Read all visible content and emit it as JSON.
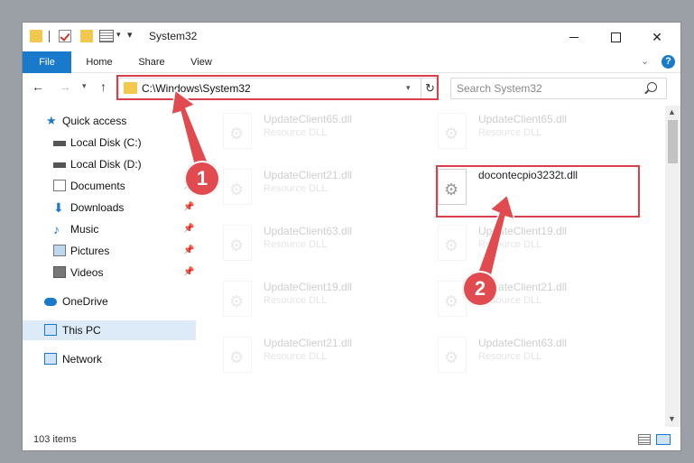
{
  "window": {
    "title": "System32"
  },
  "ribbon": {
    "tabs": [
      "File",
      "Home",
      "Share",
      "View"
    ]
  },
  "address": {
    "path": "C:\\Windows\\System32"
  },
  "search": {
    "placeholder": "Search System32"
  },
  "sidebar": {
    "items": [
      {
        "label": "Quick access",
        "icon": "star-icon",
        "pinned": false
      },
      {
        "label": "Local Disk (C:)",
        "icon": "drive-icon",
        "pinned": false
      },
      {
        "label": "Local Disk (D:)",
        "icon": "drive-icon",
        "pinned": false
      },
      {
        "label": "Documents",
        "icon": "documents-icon",
        "pinned": true
      },
      {
        "label": "Downloads",
        "icon": "download-icon",
        "pinned": true
      },
      {
        "label": "Music",
        "icon": "music-icon",
        "pinned": true
      },
      {
        "label": "Pictures",
        "icon": "pictures-icon",
        "pinned": true
      },
      {
        "label": "Videos",
        "icon": "videos-icon",
        "pinned": true
      },
      {
        "label": "OneDrive",
        "icon": "cloud-icon",
        "pinned": false
      },
      {
        "label": "This PC",
        "icon": "computer-icon",
        "pinned": false,
        "selected": true
      },
      {
        "label": "Network",
        "icon": "network-icon",
        "pinned": false
      }
    ]
  },
  "files": [
    {
      "name": "UpdateClient65.dll",
      "type": "Resource DLL"
    },
    {
      "name": "UpdateClient65.dll",
      "type": "Resource DLL"
    },
    {
      "name": "UpdateClient21.dll",
      "type": "Resource DLL"
    },
    {
      "name": "docontecpio3232t.dll",
      "type": ""
    },
    {
      "name": "UpdateClient63.dll",
      "type": "Resource DLL"
    },
    {
      "name": "UpdateClient19.dll",
      "type": "Resource DLL"
    },
    {
      "name": "UpdateClient19.dll",
      "type": "Resource DLL"
    },
    {
      "name": "UpdateClient21.dll",
      "type": "Resource DLL"
    },
    {
      "name": "UpdateClient21.dll",
      "type": "Resource DLL"
    },
    {
      "name": "UpdateClient63.dll",
      "type": "Resource DLL"
    }
  ],
  "status": {
    "items": "103 items"
  },
  "annotations": {
    "step1": "1",
    "step2": "2",
    "color": "#e14a4f"
  }
}
